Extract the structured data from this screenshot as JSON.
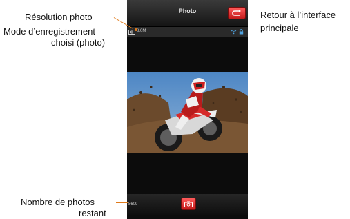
{
  "app": {
    "title": "Photo",
    "resolution": "8.0M",
    "remaining_photos": "8609"
  },
  "buttons": {
    "back_icon": "return-arrow-icon",
    "shutter_icon": "camera-icon"
  },
  "status_icons": [
    "photo-mode-icon",
    "wifi-icon",
    "lock-icon"
  ],
  "annotations": {
    "resolution": "Résolution photo",
    "mode_line1": "Mode d’enregistrement",
    "mode_line2": "choisi (photo)",
    "back_line1": "Retour à l’interface",
    "back_line2": "principale",
    "remaining_line1": "Nombre de photos",
    "remaining_line2": "restant"
  },
  "colors": {
    "accent_red": "#d62a2a",
    "leader_orange": "#e07a1a"
  }
}
